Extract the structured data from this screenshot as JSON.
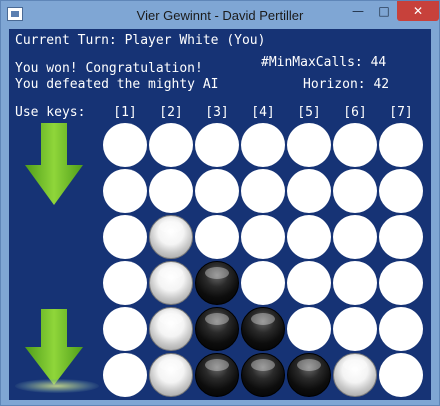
{
  "window": {
    "title": "Vier Gewinnt - David Pertiller",
    "minimize_glyph": "—",
    "maximize_glyph": "□",
    "close_glyph": "✕"
  },
  "status": {
    "current_turn": "Current Turn: Player White (You)",
    "message_line1": "You won! Congratulation!",
    "message_line2": "You defeated the mighty AI",
    "minmax_calls": "#MinMaxCalls: 44",
    "horizon": "Horizon: 42"
  },
  "keys": {
    "label": "Use keys:",
    "columns": [
      "[1]",
      "[2]",
      "[3]",
      "[4]",
      "[5]",
      "[6]",
      "[7]"
    ]
  },
  "board": {
    "columns": 7,
    "rows": 6,
    "cells": [
      [
        "empty",
        "empty",
        "empty",
        "empty",
        "empty",
        "empty",
        "empty"
      ],
      [
        "empty",
        "empty",
        "empty",
        "empty",
        "empty",
        "empty",
        "empty"
      ],
      [
        "empty",
        "white",
        "empty",
        "empty",
        "empty",
        "empty",
        "empty"
      ],
      [
        "empty",
        "white",
        "black",
        "empty",
        "empty",
        "empty",
        "empty"
      ],
      [
        "empty",
        "white",
        "black",
        "black",
        "empty",
        "empty",
        "empty"
      ],
      [
        "empty",
        "white",
        "black",
        "black",
        "black",
        "white",
        "empty"
      ]
    ]
  },
  "colors": {
    "background": "#163375",
    "arrow": "#6fbf22",
    "empty_slot": "#ffffff"
  },
  "icons": {
    "top_arrow": "down-arrow-icon",
    "bottom_arrow": "down-arrow-icon"
  }
}
